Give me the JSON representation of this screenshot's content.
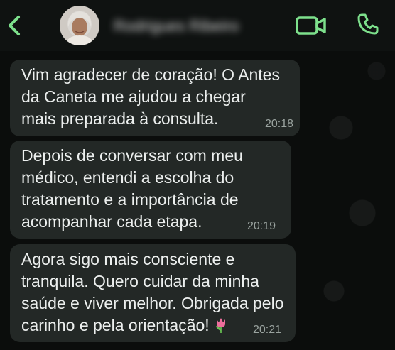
{
  "header": {
    "back_label": "back",
    "contact_name": "Rodrigues Ribeiro",
    "video_call_label": "video call",
    "voice_call_label": "voice call"
  },
  "messages": [
    {
      "text": "Vim agradecer de coração! O Antes\nda Caneta me ajudou a chegar\nmais preparada à consulta.",
      "time": "20:18"
    },
    {
      "text": "Depois de conversar com meu\nmédico, entendi a escolha do\ntratamento e a importância de\nacompanhar cada etapa.",
      "time": "20:19"
    },
    {
      "text": "Agora sigo mais consciente e\ntranquila. Quero cuidar da minha\nsaúde e viver melhor. Obrigada pelo\ncarinho e pela orientação!",
      "time": "20:21",
      "emoji_icon": "tulip-icon"
    }
  ],
  "colors": {
    "accent": "#7de08c",
    "bubble": "#232826",
    "background": "#0b0d0c",
    "text": "#ecefee",
    "timestamp": "#9aa39f"
  }
}
